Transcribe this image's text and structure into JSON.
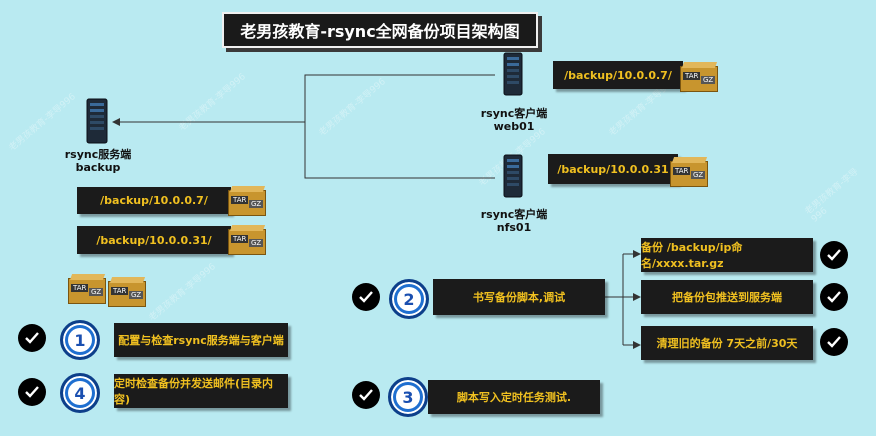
{
  "title": "老男孩教育-rsync全网备份项目架构图",
  "nodes": {
    "server": {
      "line1": "rsync服务端",
      "line2": "backup"
    },
    "web": {
      "line1": "rsync客户端",
      "line2": "web01"
    },
    "nfs": {
      "line1": "rsync客户端",
      "line2": "nfs01"
    }
  },
  "paths": {
    "web_top": "/backup/10.0.0.7/",
    "nfs_top": "/backup/10.0.0.31",
    "server_1": "/backup/10.0.0.7/",
    "server_2": "/backup/10.0.0.31/"
  },
  "archive_icon": {
    "tar": "TAR",
    "gz": "GZ"
  },
  "steps": {
    "s1": {
      "num": "1",
      "text": "配置与检查rsync服务端与客户端"
    },
    "s2": {
      "num": "2",
      "text": "书写备份脚本,调试"
    },
    "s3": {
      "num": "3",
      "text": "脚本写入定时任务测试."
    },
    "s4": {
      "num": "4",
      "text": "定时检查备份并发送邮件(目录内容)"
    }
  },
  "substeps": [
    "备份 /backup/ip命名/xxxx.tar.gz",
    "把备份包推送到服务端",
    "清理旧的备份 7天之前/30天"
  ],
  "watermark": "老男孩教育-李导996"
}
